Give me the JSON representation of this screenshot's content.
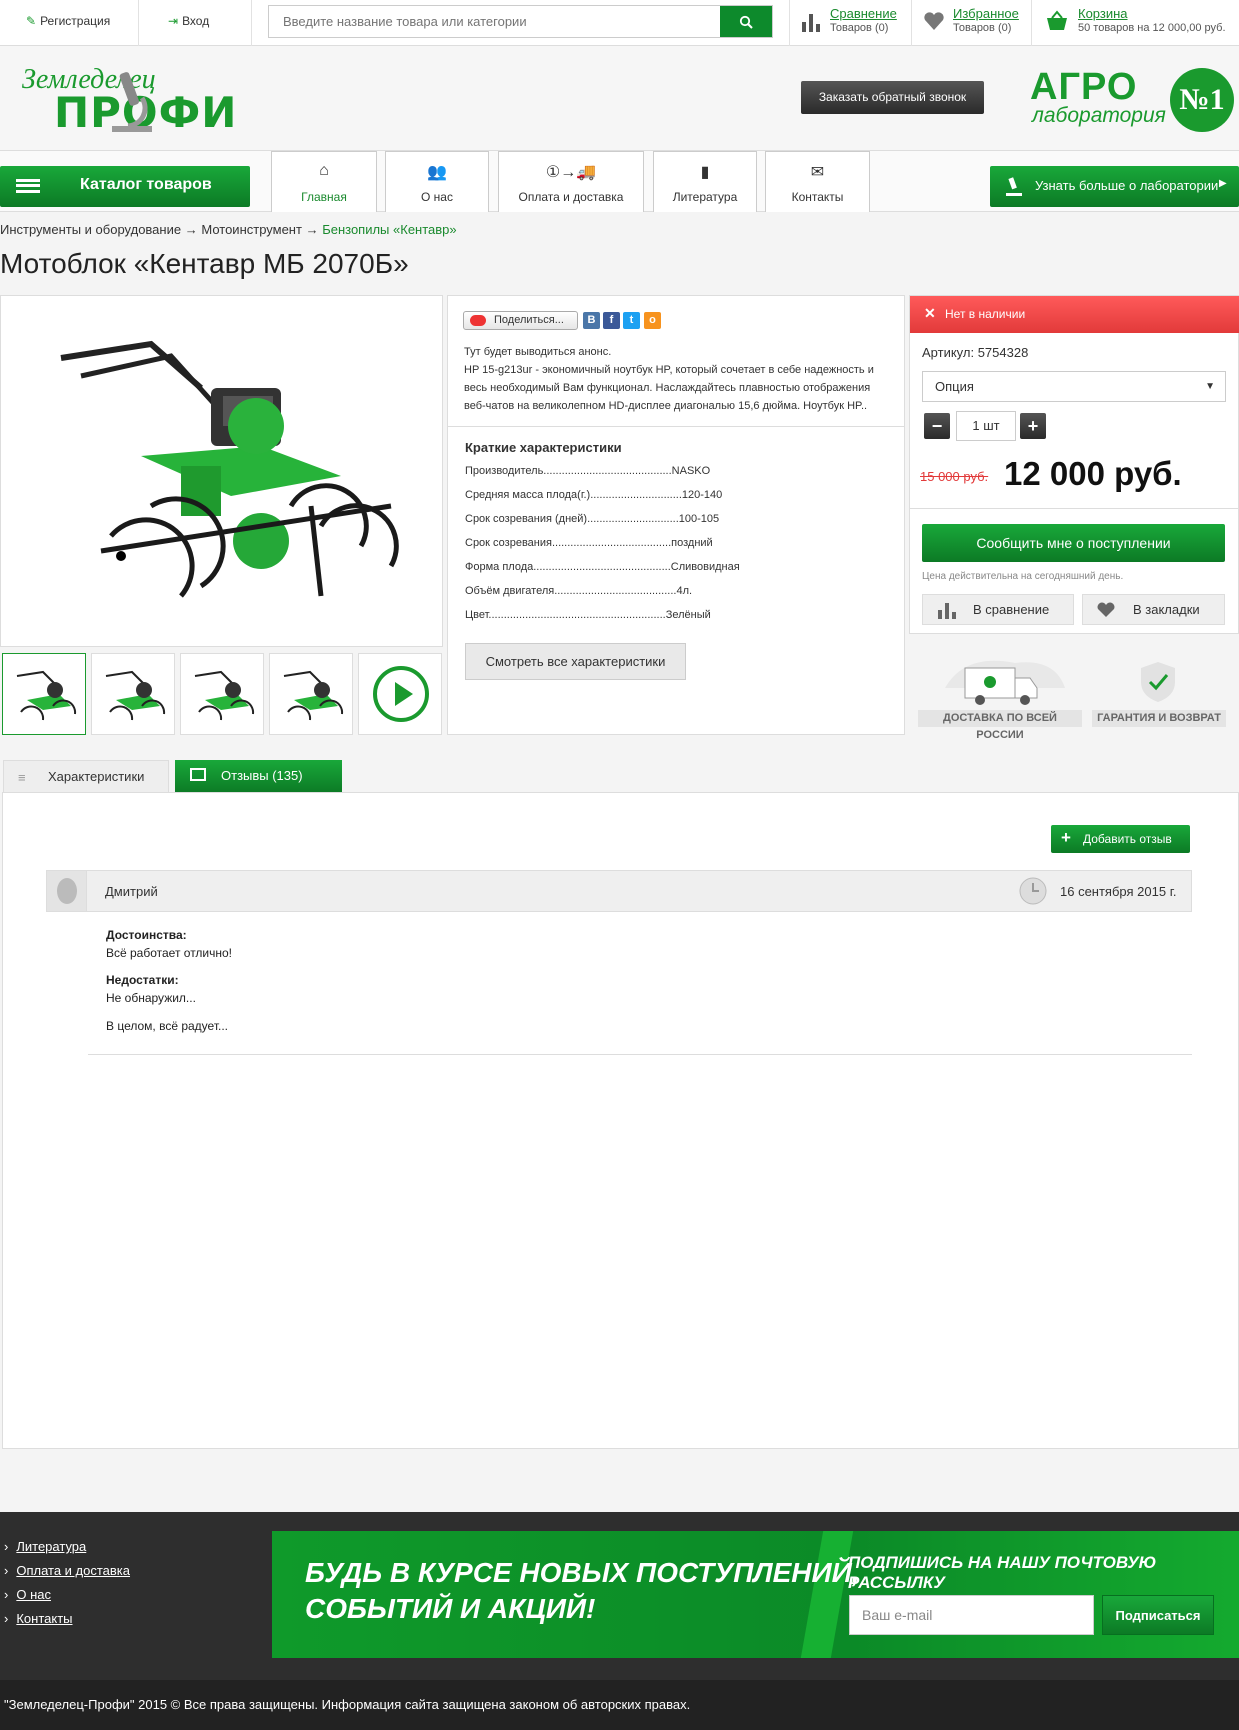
{
  "topbar": {
    "register": "Регистрация",
    "login": "Вход",
    "search_placeholder": "Введите название товара или категории",
    "compare": {
      "title": "Сравнение",
      "sub": "Товаров (0)"
    },
    "favorites": {
      "title": "Избранное",
      "sub": "Товаров (0)"
    },
    "cart": {
      "title": "Корзина",
      "sub": "50 товаров на 12 000,00 руб."
    }
  },
  "header": {
    "logo_top": "Земледелец",
    "logo_bottom": "ПРОФИ",
    "callback": "Заказать обратный звонок",
    "agro_title": "АГРО",
    "agro_sub": "лаборатория",
    "agro_badge": "№1"
  },
  "nav": {
    "catalog": "Каталог товаров",
    "tabs": [
      {
        "label": "Главная",
        "icon": "home-icon"
      },
      {
        "label": "О нас",
        "icon": "users-icon"
      },
      {
        "label": "Оплата и доставка",
        "icon": "delivery-icon"
      },
      {
        "label": "Литература",
        "icon": "book-icon"
      },
      {
        "label": "Контакты",
        "icon": "envelope-icon"
      }
    ],
    "lab_button": "Узнать больше о лаборатории"
  },
  "breadcrumbs": {
    "c1": "Инструменты и оборудование",
    "c2": "Мотоинструмент",
    "c3": "Бензопилы «Кентавр»",
    "sep": "→"
  },
  "product": {
    "title": "Мотоблок «Кентавр МБ 2070Б»",
    "share": "Поделиться...",
    "announce": "Тут будет выводиться анонс.",
    "description": "HP 15-g213ur - экономичный ноутбук HP, который сочетает в себе надежность и весь необходимый Вам функционал. Наслаждайтесь плавностью отображения веб-чатов на великолепном HD-дисплее диагональю 15,6 дюйма. Ноутбук HP..",
    "specs_title": "Краткие характеристики",
    "specs": [
      {
        "k": "Производитель..........................................",
        "v": "NASKO"
      },
      {
        "k": "Средняя масса плода(г.)..............................",
        "v": "120-140"
      },
      {
        "k": "Срок созревания (дней)..............................",
        "v": "100-105"
      },
      {
        "k": "Срок созревания.......................................",
        "v": "поздний"
      },
      {
        "k": "Форма плода.............................................",
        "v": "Сливовидная"
      },
      {
        "k": "Объём двигателя........................................",
        "v": "4л."
      },
      {
        "k": "Цвет..........................................................",
        "v": "Зелёный"
      }
    ],
    "all_specs": "Смотреть все характеристики",
    "stock": "Нет в наличии",
    "article": "Артикул: 5754328",
    "option": "Опция",
    "qty": "1 шт",
    "old_price": "15 000 руб.",
    "price": "12 000 руб.",
    "notify": "Сообщить мне о поступлении",
    "price_note": "Цена действительна на сегодняшний день.",
    "to_compare": "В сравнение",
    "to_bookmarks": "В закладки",
    "badge_delivery": "ДОСТАВКА ПО ВСЕЙ РОССИИ",
    "badge_guarantee": "ГАРАНТИЯ И ВОЗВРАТ"
  },
  "tabs": {
    "specs": "Характеристики",
    "reviews": "Отзывы (135)"
  },
  "reviews": {
    "add": "Добавить отзыв",
    "items": [
      {
        "author": "Дмитрий",
        "date": "16 сентября 2015 г.",
        "pros_label": "Достоинства:",
        "pros": "Всё работает отлично!",
        "cons_label": "Недостатки:",
        "cons": "Не обнаружил...",
        "summary": "В целом, всё радует..."
      }
    ]
  },
  "footer": {
    "links": [
      "Литература",
      "Оплата и доставка",
      "О нас",
      "Контакты"
    ],
    "banner_line1": "БУДЬ В КУРСЕ НОВЫХ ПОСТУПЛЕНИЙ,",
    "banner_line2": "СОБЫТИЙ И АКЦИЙ!",
    "subscribe_title": "ПОДПИШИСЬ НА НАШУ  ПОЧТОВУЮ РАССЫЛКУ",
    "email_placeholder": "Ваш e-mail",
    "subscribe_btn": "Подписаться",
    "copyright": "\"Земледелец-Профи\" 2015 © Все права защищены. Информация сайта защищена законом об авторских правах."
  },
  "colors": {
    "brand_green": "#1a9a2e",
    "alert_red": "#e23a3a",
    "dark": "#2e2e2e"
  }
}
